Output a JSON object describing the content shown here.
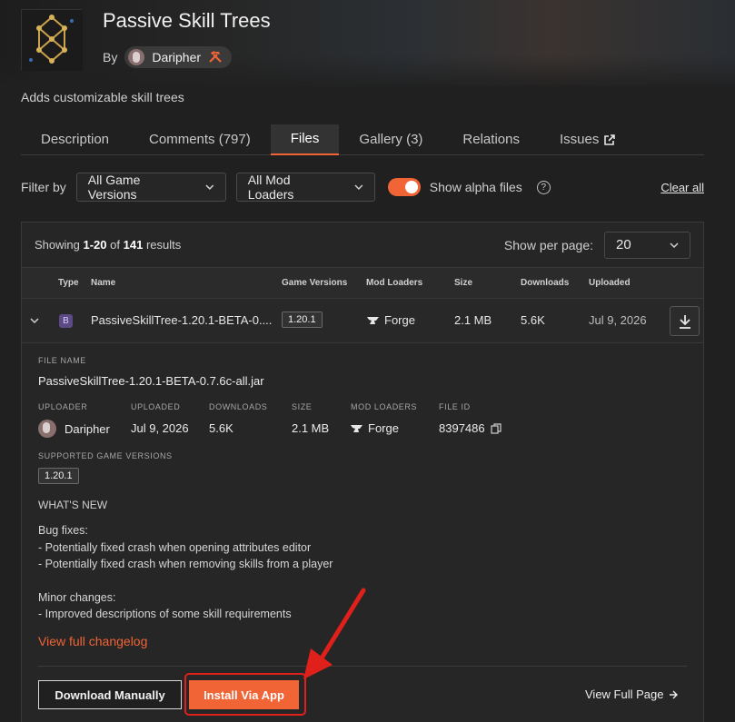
{
  "mod": {
    "title": "Passive Skill Trees",
    "by_label": "By",
    "author": "Daripher",
    "summary": "Adds customizable skill trees"
  },
  "tabs": [
    {
      "label": "Description"
    },
    {
      "label": "Comments (797)"
    },
    {
      "label": "Files"
    },
    {
      "label": "Gallery (3)"
    },
    {
      "label": "Relations"
    },
    {
      "label": "Issues"
    }
  ],
  "filters": {
    "filter_by_label": "Filter by",
    "game_versions": "All Game Versions",
    "mod_loaders": "All Mod Loaders",
    "show_alpha_label": "Show alpha files",
    "show_alpha_on": true,
    "clear_all": "Clear all"
  },
  "results": {
    "showing_prefix": "Showing",
    "range": "1-20",
    "of_label": "of",
    "total": "141",
    "results_label": "results",
    "per_page_label": "Show per page:",
    "per_page_value": "20"
  },
  "table": {
    "headers": {
      "type": "Type",
      "name": "Name",
      "game_versions": "Game Versions",
      "mod_loaders": "Mod Loaders",
      "size": "Size",
      "downloads": "Downloads",
      "uploaded": "Uploaded"
    },
    "row": {
      "type_badge": "B",
      "name": "PassiveSkillTree-1.20.1-BETA-0....",
      "game_version": "1.20.1",
      "mod_loader": "Forge",
      "size": "2.1 MB",
      "downloads": "5.6K",
      "uploaded": "Jul 9, 2026"
    }
  },
  "details": {
    "file_name_label": "FILE NAME",
    "file_name": "PassiveSkillTree-1.20.1-BETA-0.7.6c-all.jar",
    "uploader_label": "UPLOADER",
    "uploader": "Daripher",
    "uploaded_label": "UPLOADED",
    "uploaded": "Jul 9, 2026",
    "downloads_label": "DOWNLOADS",
    "downloads": "5.6K",
    "size_label": "SIZE",
    "size": "2.1 MB",
    "mod_loaders_label": "MOD LOADERS",
    "mod_loader": "Forge",
    "file_id_label": "FILE ID",
    "file_id": "8397486",
    "supported_label": "SUPPORTED GAME VERSIONS",
    "supported_version": "1.20.1",
    "whats_new_label": "WHAT'S NEW",
    "changelog": {
      "bug_heading": "Bug fixes:",
      "bug_1": "- Potentially fixed crash when opening attributes editor",
      "bug_2": "- Potentially fixed crash when removing skills from a player",
      "minor_heading": "Minor changes:",
      "minor_1": "- Improved descriptions of some skill requirements"
    },
    "view_changelog": "View full changelog"
  },
  "actions": {
    "download_manually": "Download Manually",
    "install_via_app": "Install Via App",
    "view_full_page": "View Full Page"
  },
  "colors": {
    "accent": "#f16436",
    "highlight": "#e0201b",
    "background": "#202020"
  }
}
